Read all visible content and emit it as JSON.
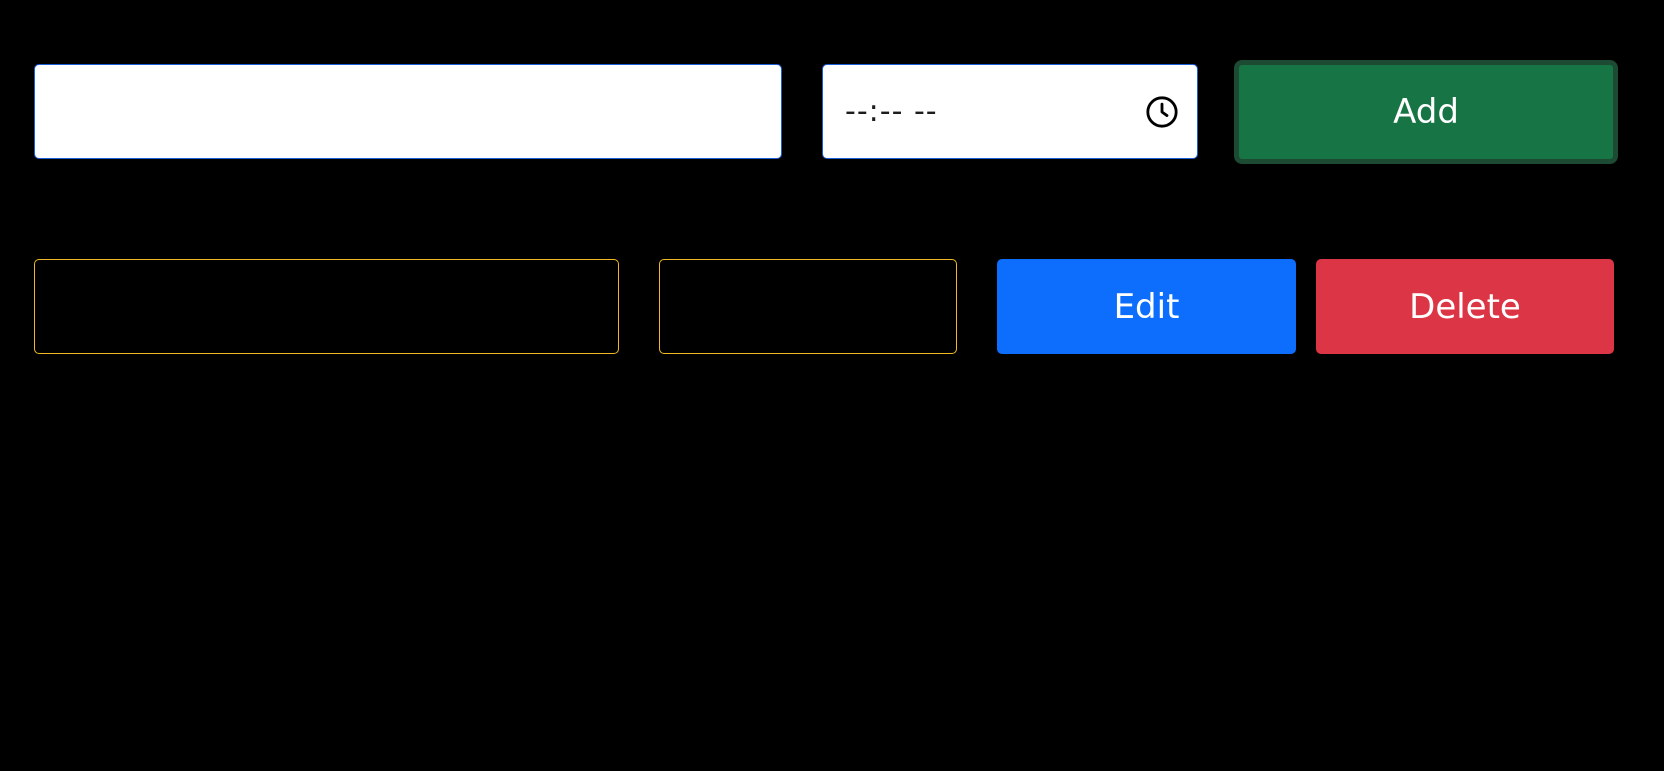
{
  "new_task": {
    "task_value": "",
    "time_display": "--:--  --",
    "add_label": "Add"
  },
  "task_row": {
    "task_value": "",
    "time_value": "",
    "edit_label": "Edit",
    "delete_label": "Delete"
  },
  "icons": {
    "time_picker": "clock-icon"
  },
  "colors": {
    "background": "#000000",
    "add": "#177445",
    "edit": "#0d6efd",
    "delete": "#dc3545",
    "row_border": "#f0b825",
    "input_border": "#1a5fd6"
  }
}
